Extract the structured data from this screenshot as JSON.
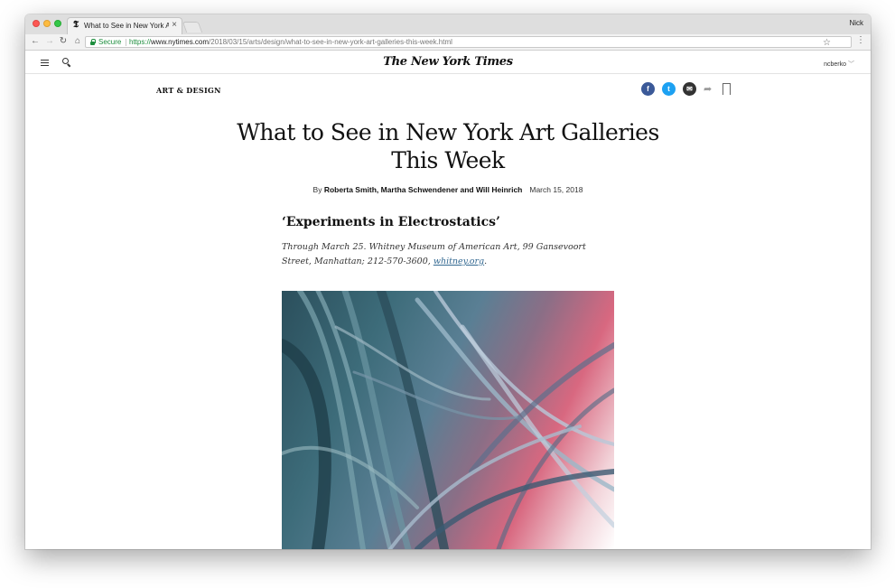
{
  "browser": {
    "tab_title": "What to See in New York Art Galleries This Week",
    "tab_favicon": "𝕿",
    "tab_close": "×",
    "profile_name": "Nick",
    "secure_label": "Secure",
    "url_scheme": "https://",
    "url_host": "www.nytimes.com",
    "url_path": "/2018/03/15/arts/design/what-to-see-in-new-york-art-galleries-this-week.html",
    "icons": [
      "back-icon",
      "forward-icon",
      "reload-icon",
      "home-icon",
      "lock-icon",
      "star-icon",
      "menu-kebab-icon"
    ],
    "back": "←",
    "forward": "→",
    "reload": "↻",
    "home": "⌂",
    "star": "☆",
    "kebab": "⋮"
  },
  "header": {
    "masthead": "The New York Times",
    "user": "ncberko",
    "user_chevron": "﹀",
    "icons": [
      "hamburger-menu-icon",
      "search-icon"
    ]
  },
  "article": {
    "section": "ART & DESIGN",
    "headline": "What to See in New York Art Galleries This Week",
    "byline_prefix": "By ",
    "author1": "Roberta Smith",
    "author_rest": ", Martha Schwendener and Will Heinrich",
    "date": "March 15, 2018",
    "subhead": "‘Experiments in Electrostatics’",
    "info_text": "Through March 25. Whitney Museum of American Art, 99 Gansevoort Street, Manhattan; 212-570-3600, ",
    "info_link": "whitney.org",
    "info_end": ".",
    "share": {
      "facebook": "f",
      "twitter": "t",
      "email": "✉",
      "more": "➦"
    }
  },
  "colors": {
    "facebook": "#3b5998",
    "twitter": "#1da1f2",
    "secure_green": "#1e8e3e",
    "link_blue": "#326891"
  }
}
